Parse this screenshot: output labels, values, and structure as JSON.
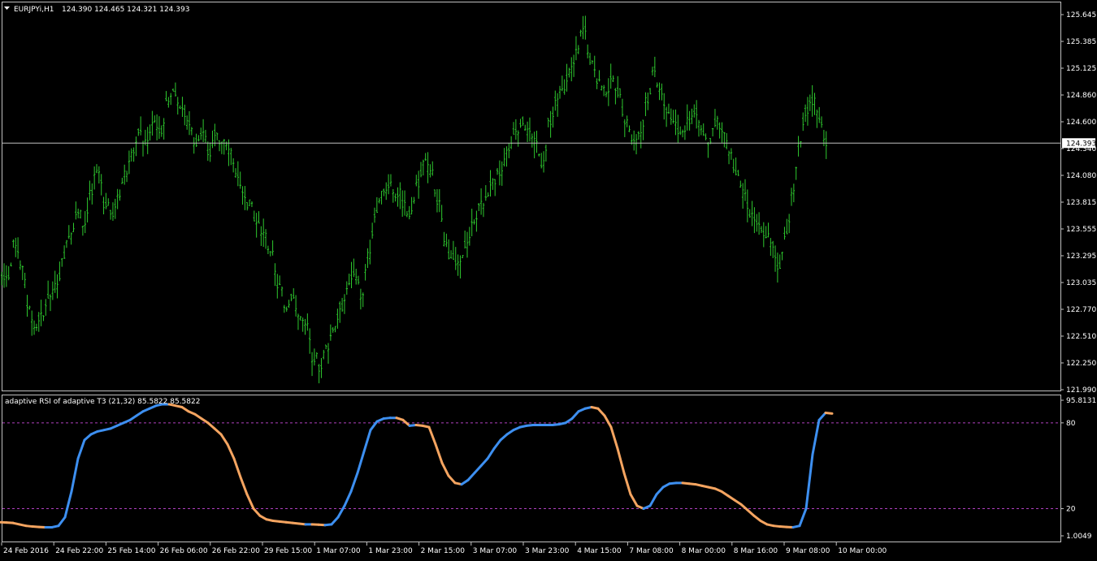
{
  "colors": {
    "background": "#000000",
    "frame": "#c0c0c0",
    "bar": "#2ec82e",
    "bid_line": "#c0c0c0",
    "rsi_up": "#3d8ff0",
    "rsi_down": "#f4a460",
    "level_line": "#b040c0"
  },
  "main_header": {
    "symbol": "EURJPYi,H1",
    "ohlc": "124.390 124.465 124.321 124.393"
  },
  "sub_header": {
    "label": "adaptive RSI of adaptive T3 (21,32) 85.5822 85.5822"
  },
  "chart_data": [
    {
      "type": "ohlc",
      "symbol": "EURJPYi",
      "timeframe": "H1",
      "last": {
        "open": 124.39,
        "high": 124.465,
        "low": 124.321,
        "close": 124.393
      },
      "bid_line": 124.393,
      "bid_label": "124.393",
      "ylim": [
        121.99,
        125.645
      ],
      "y_ticks": [
        "125.645",
        "125.385",
        "125.125",
        "124.860",
        "124.600",
        "124.340",
        "124.080",
        "123.815",
        "123.555",
        "123.295",
        "123.035",
        "122.770",
        "122.510",
        "122.250",
        "121.990"
      ],
      "x_ticks": [
        "24 Feb 2016",
        "24 Feb 22:00",
        "25 Feb 14:00",
        "26 Feb 06:00",
        "26 Feb 22:00",
        "29 Feb 15:00",
        "1 Mar 07:00",
        "1 Mar 23:00",
        "2 Mar 15:00",
        "3 Mar 07:00",
        "3 Mar 23:00",
        "4 Mar 15:00",
        "7 Mar 08:00",
        "8 Mar 00:00",
        "8 Mar 16:00",
        "9 Mar 08:00",
        "10 Mar 00:00"
      ],
      "closes": [
        123.1,
        123.4,
        123.2,
        122.8,
        122.6,
        122.7,
        122.9,
        123.0,
        123.3,
        123.5,
        123.7,
        123.6,
        123.9,
        124.1,
        123.8,
        123.7,
        123.9,
        124.1,
        124.3,
        124.5,
        124.4,
        124.6,
        124.5,
        124.8,
        124.9,
        124.7,
        124.6,
        124.4,
        124.5,
        124.3,
        124.5,
        124.4,
        124.3,
        124.1,
        123.9,
        123.8,
        123.6,
        123.5,
        123.3,
        123.0,
        122.8,
        122.9,
        122.7,
        122.6,
        122.3,
        122.2,
        122.4,
        122.6,
        122.8,
        123.0,
        123.1,
        122.9,
        123.3,
        123.7,
        123.9,
        124.0,
        123.9,
        123.8,
        123.7,
        124.0,
        124.2,
        124.1,
        123.8,
        123.4,
        123.3,
        123.2,
        123.4,
        123.6,
        123.8,
        123.9,
        124.0,
        124.1,
        124.3,
        124.5,
        124.6,
        124.5,
        124.4,
        124.2,
        124.6,
        124.8,
        124.9,
        125.1,
        125.3,
        125.5,
        125.2,
        125.0,
        124.9,
        125.0,
        124.9,
        124.6,
        124.4,
        124.5,
        124.8,
        125.1,
        124.9,
        124.7,
        124.6,
        124.5,
        124.6,
        124.7,
        124.5,
        124.4,
        124.6,
        124.5,
        124.3,
        124.1,
        123.9,
        123.7,
        123.6,
        123.5,
        123.4,
        123.2,
        123.5,
        123.9,
        124.4,
        124.7,
        124.8,
        124.6,
        124.4
      ]
    },
    {
      "type": "line",
      "name": "adaptive RSI of adaptive T3 (21,32)",
      "ylim": [
        1.0049,
        95.8131
      ],
      "levels": [
        80,
        20
      ],
      "y_ticks": [
        "95.8131",
        "80",
        "20",
        "1.0049"
      ],
      "x": [
        1,
        8,
        16,
        24,
        32,
        40,
        48,
        56,
        64,
        72,
        80,
        88,
        96,
        104,
        112,
        120,
        128,
        136,
        144,
        152,
        160,
        168,
        176,
        184,
        192,
        200,
        208,
        216,
        224,
        232,
        240,
        248,
        256,
        264,
        272,
        280,
        288,
        296,
        304,
        312,
        320,
        328,
        336,
        344,
        352,
        360,
        368,
        376,
        384,
        392,
        400,
        408,
        416,
        424,
        432,
        440,
        448,
        456,
        464,
        472,
        480,
        488,
        496,
        504,
        512,
        520,
        528,
        536,
        544,
        552,
        560,
        568,
        576,
        584,
        592,
        600,
        608,
        616,
        624,
        632,
        640,
        648,
        656,
        664,
        672,
        680,
        688,
        696,
        704,
        712,
        720,
        728,
        736,
        744,
        752,
        760,
        768,
        776,
        784,
        792,
        800,
        808,
        816,
        824,
        832,
        840,
        848,
        856,
        864,
        872,
        880,
        888,
        896,
        904,
        912,
        920,
        928,
        936,
        944,
        952,
        960,
        968,
        976,
        984,
        992,
        1000,
        1008,
        1016,
        1024,
        1032
      ],
      "values": [
        10.5,
        10.3,
        10.0,
        9.0,
        8.0,
        7.5,
        7.2,
        7.0,
        7.0,
        8.0,
        14.0,
        32.0,
        55.0,
        68.0,
        72.0,
        74.0,
        75.0,
        76.0,
        78.0,
        80.0,
        82.0,
        85.0,
        88.0,
        90.0,
        92.0,
        93.0,
        93.0,
        92.0,
        91.0,
        88.0,
        86.0,
        83.0,
        80.0,
        76.0,
        72.0,
        65.0,
        55.0,
        42.0,
        30.0,
        20.0,
        15.0,
        12.5,
        11.5,
        11.0,
        10.5,
        10.0,
        9.5,
        9.0,
        9.0,
        8.8,
        8.5,
        9.0,
        14.0,
        22.0,
        32.0,
        45.0,
        60.0,
        75.0,
        81.0,
        83.0,
        83.5,
        83.5,
        82.0,
        78.0,
        78.5,
        78.0,
        77.0,
        65.0,
        52.0,
        43.0,
        38.0,
        37.0,
        40.0,
        45.0,
        50.0,
        55.0,
        62.0,
        68.0,
        72.0,
        75.0,
        77.0,
        78.0,
        78.5,
        78.5,
        78.5,
        78.5,
        79.0,
        80.0,
        83.0,
        88.0,
        90.0,
        91.0,
        90.0,
        85.0,
        77.0,
        62.0,
        45.0,
        30.0,
        22.0,
        20.0,
        22.0,
        30.0,
        35.0,
        37.5,
        38.0,
        38.0,
        37.5,
        37.0,
        36.0,
        35.0,
        34.0,
        32.0,
        29.0,
        26.0,
        23.0,
        19.0,
        15.0,
        11.5,
        9.0,
        8.0,
        7.5,
        7.2,
        7.0,
        8.0,
        20.0,
        58.0,
        82.0,
        87.0,
        86.5
      ]
    }
  ]
}
